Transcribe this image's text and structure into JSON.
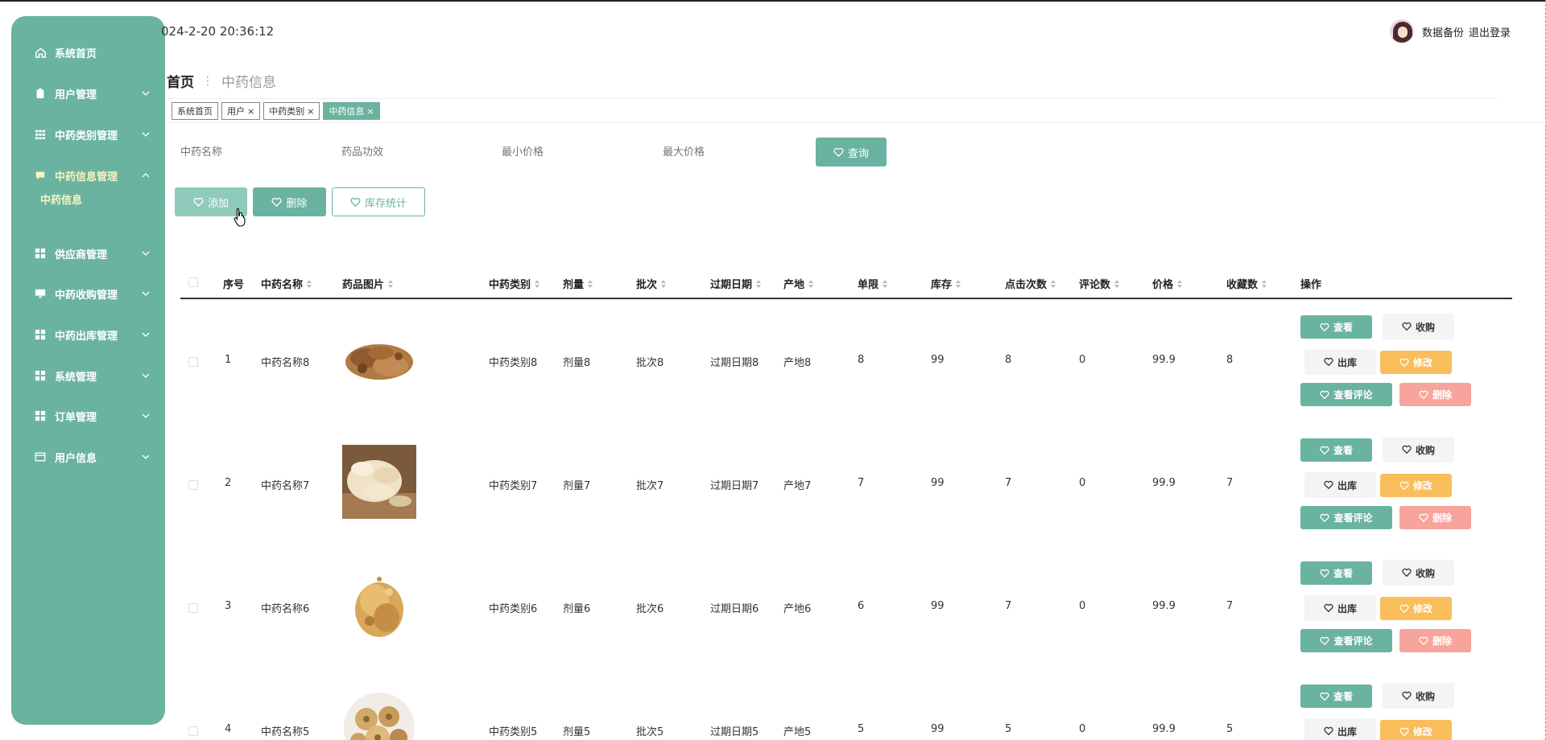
{
  "colors": {
    "primary": "#6ab3a0",
    "warning": "#f9bd5b",
    "danger": "#f6a49c"
  },
  "sidebar": {
    "items": [
      {
        "label": "系统首页",
        "icon": "home-icon"
      },
      {
        "label": "用户管理",
        "icon": "clipboard-icon"
      },
      {
        "label": "中药类别管理",
        "icon": "grid-icon"
      },
      {
        "label": "中药信息管理",
        "icon": "chat-icon"
      },
      {
        "label": "供应商管理",
        "icon": "apps-icon"
      },
      {
        "label": "中药收购管理",
        "icon": "monitor-icon"
      },
      {
        "label": "中药出库管理",
        "icon": "apps-icon"
      },
      {
        "label": "系统管理",
        "icon": "apps-icon"
      },
      {
        "label": "订单管理",
        "icon": "apps-icon"
      },
      {
        "label": "用户信息",
        "icon": "card-icon"
      }
    ],
    "sub_item": "中药信息"
  },
  "header": {
    "datetime": "024-2-20 20:36:12",
    "backup": "数据备份",
    "logout": "退出登录"
  },
  "breadcrumb": {
    "home": "首页",
    "current": "中药信息"
  },
  "tabs": [
    {
      "label": "系统首页",
      "close": ""
    },
    {
      "label": "用户",
      "close": "×"
    },
    {
      "label": "中药类别",
      "close": "×"
    },
    {
      "label": "中药信息",
      "close": "×"
    }
  ],
  "search": {
    "name_placeholder": "中药名称",
    "effect_placeholder": "药品功效",
    "min_price_placeholder": "最小价格",
    "max_price_placeholder": "最大价格",
    "query_label": "查询"
  },
  "toolbar": {
    "add": "添加",
    "delete": "删除",
    "stats": "库存统计"
  },
  "table": {
    "headers": {
      "index": "序号",
      "name": "中药名称",
      "image": "药品图片",
      "category": "中药类别",
      "dose": "剂量",
      "batch": "批次",
      "expiry": "过期日期",
      "origin": "产地",
      "limit": "单限",
      "stock": "库存",
      "clicks": "点击次数",
      "comments": "评论数",
      "price": "价格",
      "favorites": "收藏数",
      "actions": "操作"
    },
    "rows": [
      {
        "index": "1",
        "name": "中药名称8",
        "category": "中药类别8",
        "dose": "剂量8",
        "batch": "批次8",
        "expiry": "过期日期8",
        "origin": "产地8",
        "limit": "8",
        "stock": "99",
        "clicks": "8",
        "comments": "0",
        "price": "99.9",
        "favorites": "8",
        "image": "root-slices"
      },
      {
        "index": "2",
        "name": "中药名称7",
        "category": "中药类别7",
        "dose": "剂量7",
        "batch": "批次7",
        "expiry": "过期日期7",
        "origin": "产地7",
        "limit": "7",
        "stock": "99",
        "clicks": "7",
        "comments": "0",
        "price": "99.9",
        "favorites": "7",
        "image": "white-slices"
      },
      {
        "index": "3",
        "name": "中药名称6",
        "category": "中药类别6",
        "dose": "剂量6",
        "batch": "批次6",
        "expiry": "过期日期6",
        "origin": "产地6",
        "limit": "6",
        "stock": "99",
        "clicks": "7",
        "comments": "0",
        "price": "99.9",
        "favorites": "7",
        "image": "herb-pile"
      },
      {
        "index": "4",
        "name": "中药名称5",
        "category": "中药类别5",
        "dose": "剂量5",
        "batch": "批次5",
        "expiry": "过期日期5",
        "origin": "产地5",
        "limit": "5",
        "stock": "99",
        "clicks": "5",
        "comments": "0",
        "price": "99.9",
        "favorites": "5",
        "image": "round-slices"
      }
    ],
    "actions": {
      "view": "查看",
      "buy": "收购",
      "out": "出库",
      "edit": "修改",
      "comments": "查看评论",
      "delete": "删除"
    }
  }
}
